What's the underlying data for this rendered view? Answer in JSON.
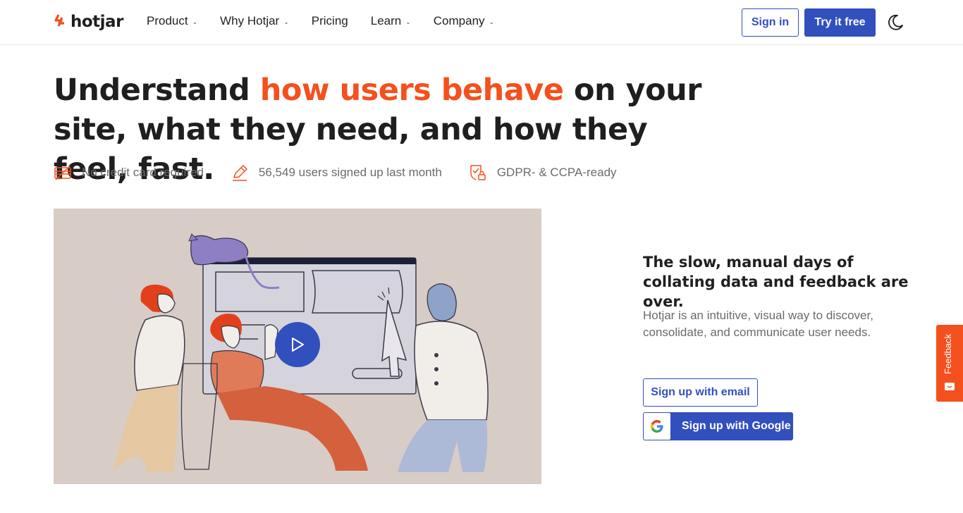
{
  "brand": {
    "name": "hotjar",
    "accent_color": "#f4501e",
    "primary_color": "#324fbe"
  },
  "nav": {
    "items": [
      {
        "label": "Product",
        "dropdown": true
      },
      {
        "label": "Why Hotjar",
        "dropdown": true
      },
      {
        "label": "Pricing",
        "dropdown": false
      },
      {
        "label": "Learn",
        "dropdown": true
      },
      {
        "label": "Company",
        "dropdown": true
      }
    ],
    "chevron": "⌄",
    "sign_in": "Sign in",
    "try_free": "Try it free",
    "theme_toggle_icon": "moon-icon"
  },
  "hero": {
    "headline_part1": "Understand ",
    "headline_accent": "how users behave",
    "headline_part2": " on your site, what they need, and how they feel, fast.",
    "features": [
      {
        "icon": "no-credit-card-icon",
        "text": "No credit card required"
      },
      {
        "icon": "pencil-icon",
        "text": "56,549 users signed up last month"
      },
      {
        "icon": "shield-check-icon",
        "text": "GDPR- & CCPA-ready"
      }
    ]
  },
  "video": {
    "play_icon": "play-icon"
  },
  "side": {
    "title": "The slow, manual days of collating data and feedback are over.",
    "description": "Hotjar is an intuitive, visual way to discover, consolidate, and communicate user needs.",
    "signup_email": "Sign up with email",
    "signup_google": "Sign up with Google"
  },
  "feedback_tab": {
    "label": "Feedback"
  }
}
